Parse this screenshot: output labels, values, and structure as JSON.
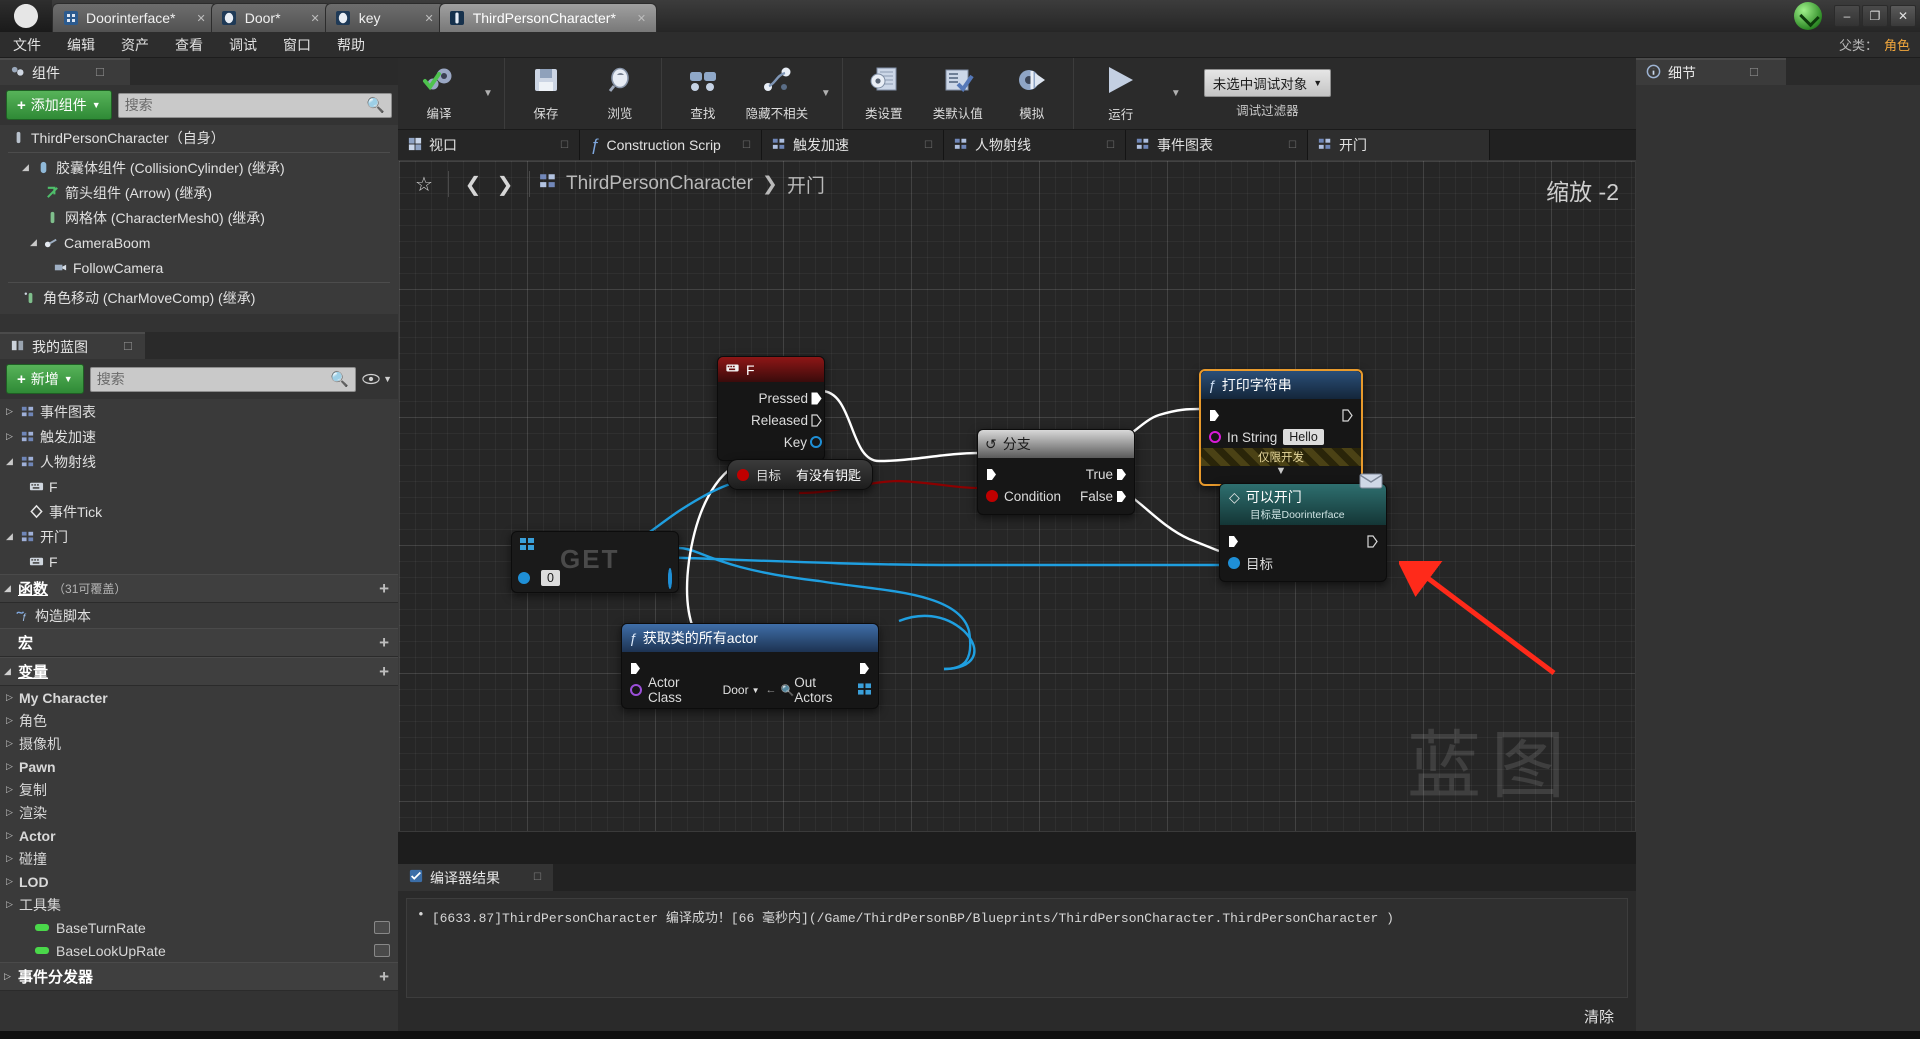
{
  "window": {
    "logo": "ue-logo",
    "tabs": [
      {
        "label": "Doorinterface*",
        "icon": "blueprint-interface-icon",
        "active": false
      },
      {
        "label": "Door*",
        "icon": "blueprint-class-icon",
        "active": false
      },
      {
        "label": "key",
        "icon": "blueprint-class-icon",
        "active": false
      },
      {
        "label": "ThirdPersonCharacter*",
        "icon": "character-blueprint-icon",
        "active": true
      }
    ],
    "close_glyph": "✕",
    "controls": {
      "minimize": "–",
      "maximize": "❐",
      "close": "✕"
    }
  },
  "menubar": {
    "items": [
      "文件",
      "编辑",
      "资产",
      "查看",
      "调试",
      "窗口",
      "帮助"
    ],
    "parent_label": "父类：",
    "parent_value": "角色"
  },
  "components_panel": {
    "tab_title": "组件",
    "tab_icon": "components-icon",
    "add_button": "添加组件",
    "search_placeholder": "搜索",
    "tree": [
      {
        "label": "ThirdPersonCharacter（自身）",
        "depth": 0,
        "arrow": "",
        "icon": "character-icon"
      },
      {
        "label": "胶囊体组件 (CollisionCylinder) (继承)",
        "depth": 1,
        "arrow": "◢",
        "icon": "capsule-icon"
      },
      {
        "label": "箭头组件 (Arrow) (继承)",
        "depth": 2,
        "arrow": "",
        "icon": "arrow-icon"
      },
      {
        "label": "网格体 (CharacterMesh0) (继承)",
        "depth": 2,
        "arrow": "",
        "icon": "mesh-icon"
      },
      {
        "label": "CameraBoom",
        "depth": 1,
        "arrow": "◢",
        "icon": "spring-arm-icon"
      },
      {
        "label": "FollowCamera",
        "depth": 2,
        "arrow": "",
        "icon": "camera-icon"
      },
      {
        "label": "角色移动 (CharMoveComp) (继承)",
        "depth": 1,
        "arrow": "",
        "icon": "movement-icon"
      }
    ]
  },
  "myblueprint_panel": {
    "tab_title": "我的蓝图",
    "tab_icon": "book-icon",
    "add_button": "新增",
    "search_placeholder": "搜索",
    "eye_icon": "eye-icon",
    "graphs": [
      {
        "label": "事件图表",
        "arrow": "▷",
        "icon": "graph-icon",
        "depth": 0
      },
      {
        "label": "触发加速",
        "arrow": "▷",
        "icon": "graph-icon",
        "depth": 0
      },
      {
        "label": "人物射线",
        "arrow": "◢",
        "icon": "graph-icon",
        "depth": 0
      },
      {
        "label": "F",
        "arrow": "",
        "icon": "input-event-icon",
        "depth": 1
      },
      {
        "label": "事件Tick",
        "arrow": "",
        "icon": "event-icon",
        "depth": 1
      },
      {
        "label": "开门",
        "arrow": "◢",
        "icon": "graph-icon",
        "depth": 0
      },
      {
        "label": "F",
        "arrow": "",
        "icon": "input-event-icon",
        "depth": 1
      }
    ],
    "sections": [
      {
        "name": "函数",
        "sub": "（31可覆盖）",
        "arrow": "◢",
        "plus": "+"
      },
      {
        "name": "宏",
        "sub": "",
        "arrow": "",
        "plus": "+"
      },
      {
        "name": "变量",
        "sub": "",
        "arrow": "◢",
        "plus": "+"
      }
    ],
    "function_items": [
      {
        "label": "构造脚本",
        "icon": "function-icon"
      }
    ],
    "variable_categories": [
      {
        "label": "My Character",
        "arrow": "▷",
        "bold": true
      },
      {
        "label": "角色",
        "arrow": "▷",
        "bold": false
      },
      {
        "label": "摄像机",
        "arrow": "▷",
        "bold": false
      },
      {
        "label": "Pawn",
        "arrow": "▷",
        "bold": true
      },
      {
        "label": "复制",
        "arrow": "▷",
        "bold": false
      },
      {
        "label": "渲染",
        "arrow": "▷",
        "bold": false
      },
      {
        "label": "Actor",
        "arrow": "▷",
        "bold": true
      },
      {
        "label": "碰撞",
        "arrow": "▷",
        "bold": false
      },
      {
        "label": "LOD",
        "arrow": "▷",
        "bold": true
      },
      {
        "label": "工具集",
        "arrow": "▷",
        "bold": false
      }
    ],
    "variables": [
      {
        "label": "BaseTurnRate",
        "color": "#4ad84a"
      },
      {
        "label": "BaseLookUpRate",
        "color": "#4ad84a"
      }
    ],
    "dispatchers_section": {
      "name": "事件分发器",
      "plus": "+"
    }
  },
  "toolbar": {
    "groups": [
      {
        "items": [
          {
            "label": "编译",
            "icon": "compile-icon"
          }
        ],
        "carat": true
      },
      {
        "items": [
          {
            "label": "保存",
            "icon": "save-icon"
          },
          {
            "label": "浏览",
            "icon": "browse-icon"
          }
        ],
        "carat": false
      },
      {
        "items": [
          {
            "label": "查找",
            "icon": "find-icon"
          },
          {
            "label": "隐藏不相关",
            "icon": "hide-unrelated-icon"
          }
        ],
        "carat": true
      },
      {
        "items": [
          {
            "label": "类设置",
            "icon": "class-settings-icon"
          },
          {
            "label": "类默认值",
            "icon": "class-defaults-icon"
          },
          {
            "label": "模拟",
            "icon": "simulate-icon"
          }
        ],
        "carat": false
      },
      {
        "items": [
          {
            "label": "运行",
            "icon": "play-icon"
          }
        ],
        "carat": true
      }
    ],
    "debug_object": "未选中调试对象",
    "debug_filter": "调试过滤器"
  },
  "graph_tabs": [
    {
      "label": "视口",
      "icon": "viewport-icon",
      "selected": false
    },
    {
      "label": "Construction Scrip",
      "icon": "function-icon",
      "selected": false
    },
    {
      "label": "触发加速",
      "icon": "graph-icon",
      "selected": false
    },
    {
      "label": "人物射线",
      "icon": "graph-icon",
      "selected": false
    },
    {
      "label": "事件图表",
      "icon": "graph-icon",
      "selected": false
    },
    {
      "label": "开门",
      "icon": "graph-icon",
      "selected": true
    }
  ],
  "graph": {
    "star_icon": "bookmark-star-icon",
    "back_icon": "back-arrow-icon",
    "forward_icon": "forward-arrow-icon",
    "breadcrumb_icon": "graph-icon",
    "breadcrumb_root": "ThirdPersonCharacter",
    "breadcrumb_sep": "❯",
    "breadcrumb_leaf": "开门",
    "zoom_label": "缩放 -2",
    "watermark": "蓝图",
    "nodes": {
      "input_f": {
        "title": "F",
        "icon": "input-event-icon",
        "pins": [
          {
            "label": "Pressed",
            "type": "exec-out",
            "filled": true
          },
          {
            "label": "Released",
            "type": "exec-out",
            "filled": false
          },
          {
            "label": "Key",
            "type": "data-out",
            "color": "blue"
          }
        ]
      },
      "branch": {
        "title": "分支",
        "icon": "branch-icon",
        "in_exec": "",
        "condition_label": "Condition",
        "true_label": "True",
        "false_label": "False"
      },
      "print_string": {
        "title": "打印字符串",
        "icon": "function-icon",
        "in_string_label": "In String",
        "in_string_value": "Hello",
        "dev_only": "仅限开发",
        "selected": true
      },
      "has_key": {
        "title": "有没有钥匙",
        "target_label": "目标",
        "icon": "variable-get-icon"
      },
      "can_open_door": {
        "title": "可以开门",
        "subtitle": "目标是Doorinterface",
        "target_label": "目标",
        "icon": "interface-message-icon",
        "comment_icon": "comment-bubble-icon"
      },
      "get_array": {
        "title": "GET",
        "index_value": "0",
        "icon": "array-get-icon"
      },
      "get_all_actors": {
        "title": "获取类的所有actor",
        "icon": "function-icon",
        "actor_class_label": "Actor Class",
        "actor_class_value": "Door",
        "out_actors_label": "Out Actors"
      }
    }
  },
  "results_panel": {
    "tab_title": "编译器结果",
    "tab_icon": "compiler-results-icon",
    "lines": [
      "[6633.87]ThirdPersonCharacter 编译成功！[66 毫秒内](/Game/ThirdPersonBP/Blueprints/ThirdPersonCharacter.ThirdPersonCharacter )"
    ],
    "bullet": "•",
    "clear_label": "清除"
  },
  "details_panel": {
    "tab_title": "细节",
    "tab_icon": "details-icon"
  },
  "colors": {
    "accent_green": "#3f9c41",
    "selected_node": "#e89a2c",
    "exec_wire": "#ffffff",
    "bool_wire": "#8c0000",
    "object_wire": "#1f9fe0",
    "annotation_arrow": "#ff2a1a"
  }
}
